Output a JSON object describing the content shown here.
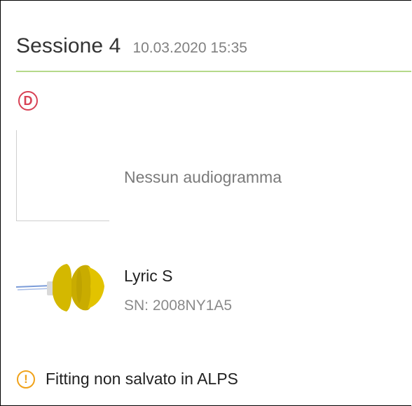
{
  "session": {
    "title": "Sessione 4",
    "datetime": "10.03.2020 15:35",
    "badge_letter": "D"
  },
  "audiogram": {
    "empty_text": "Nessun audiogramma"
  },
  "device": {
    "name": "Lyric S",
    "serial": "SN: 2008NY1A5",
    "icon": "hearing-aid-icon"
  },
  "warning": {
    "text": "Fitting non salvato in ALPS",
    "icon": "warning-circle-icon"
  },
  "colors": {
    "accent_line": "#b5d98a",
    "badge": "#d84255",
    "warning": "#f0a21a"
  }
}
